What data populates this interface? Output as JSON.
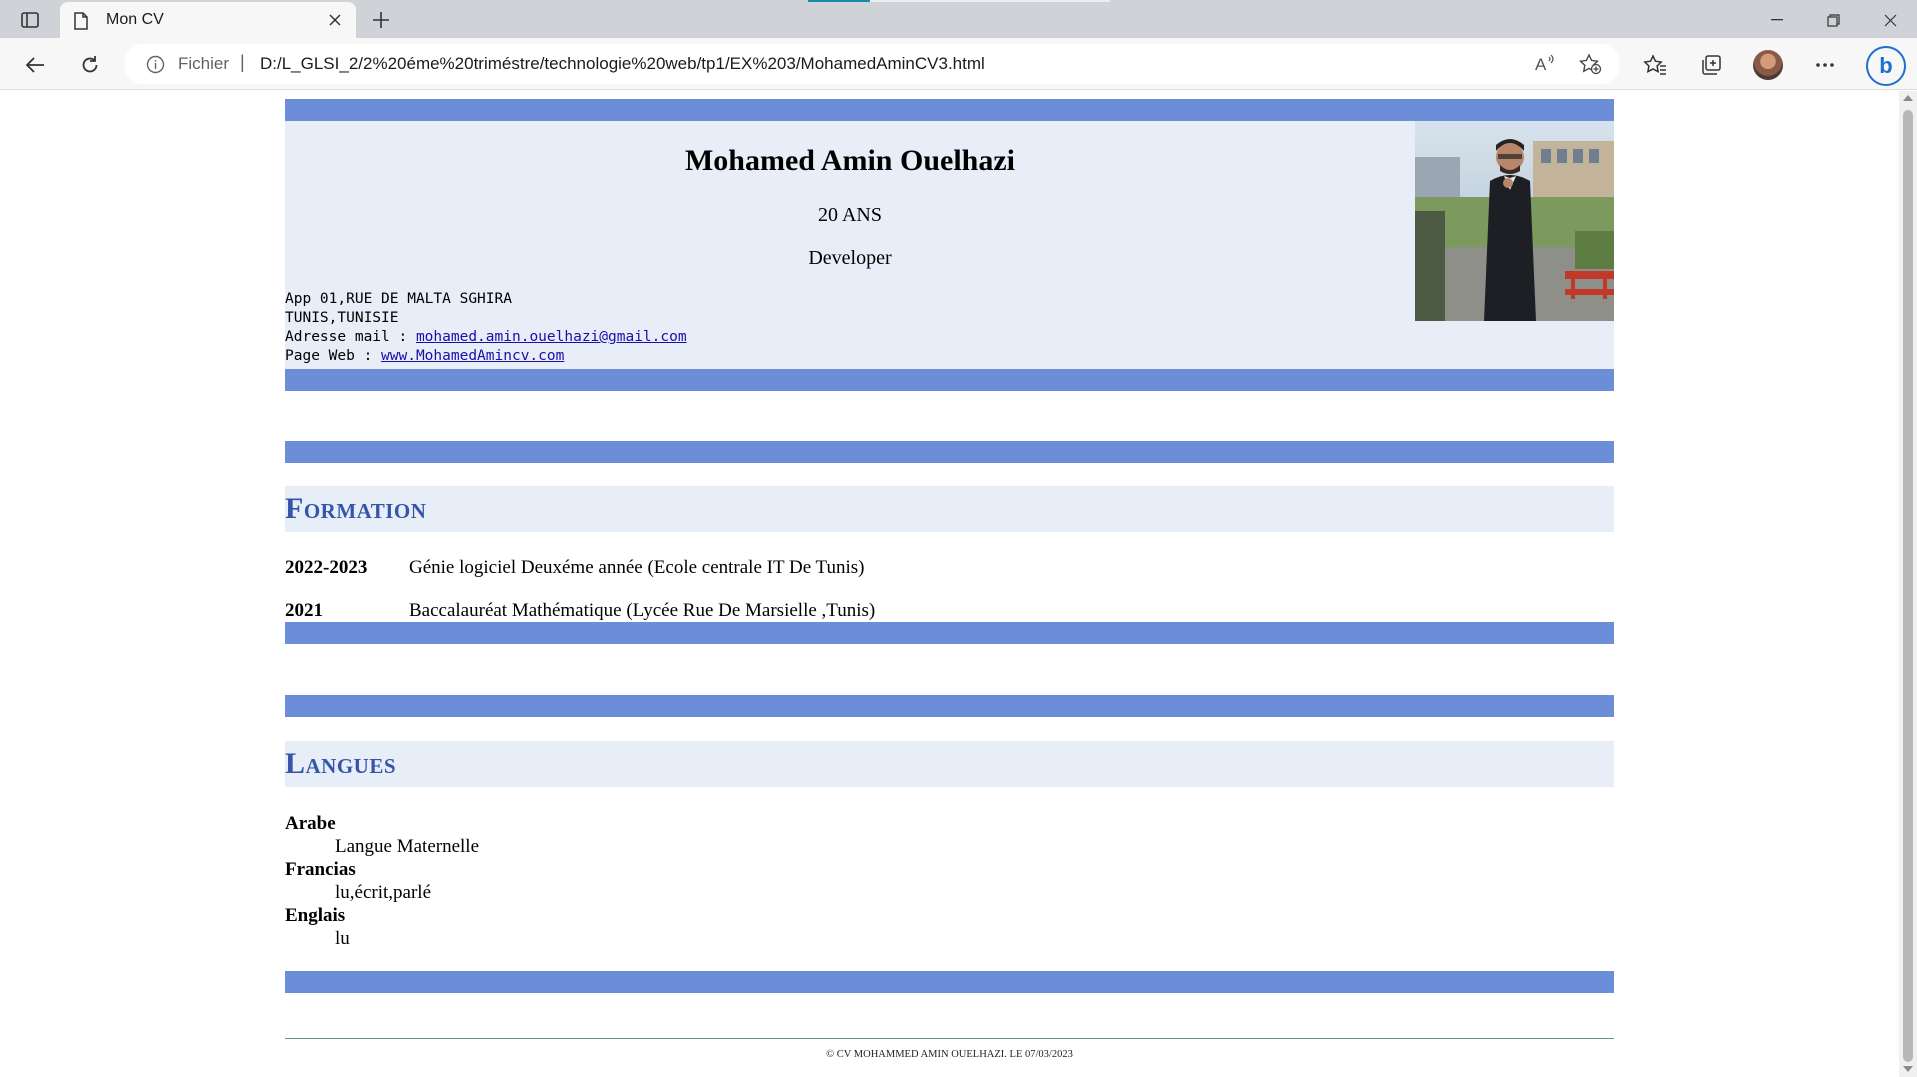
{
  "browser": {
    "tab_title": "Mon CV",
    "scheme_label": "Fichier",
    "separator": "|",
    "url": "D:/L_GLSI_2/2%20éme%20triméstre/technologie%20web/tp1/EX%203/MohamedAminCV3.html",
    "accent_color": "#1c6fd1",
    "bing_label": "b"
  },
  "cv": {
    "name": "Mohamed Amin Ouelhazi",
    "age": "20 ANS",
    "job": "Developer",
    "address_line1": "App 01,RUE DE MALTA SGHIRA",
    "address_line2": "TUNIS,TUNISIE",
    "email_label": "Adresse mail : ",
    "email": "mohamed.amin.ouelhazi@gmail.com",
    "web_label": "Page Web : ",
    "web": "www.MohamedAmincv.com",
    "bar_color": "#6c8ed9",
    "panel_color": "#e7eef8",
    "title_color": "#3556a8"
  },
  "formation": {
    "title": "Formation",
    "items": [
      {
        "year": "2022-2023",
        "desc": "Génie logiciel Deuxéme année (Ecole centrale IT De Tunis)"
      },
      {
        "year": "2021",
        "desc": "Baccalauréat Mathématique (Lycée Rue De Marsielle ,Tunis)"
      }
    ]
  },
  "langues": {
    "title": "Langues",
    "items": [
      {
        "name": "Arabe",
        "level": "Langue Maternelle"
      },
      {
        "name": "Francias",
        "level": "lu,écrit,parlé"
      },
      {
        "name": "Englais",
        "level": "lu"
      }
    ]
  },
  "footer": {
    "text": "© CV MOHAMMED AMIN OUELHAZI. LE 07/03/2023"
  }
}
